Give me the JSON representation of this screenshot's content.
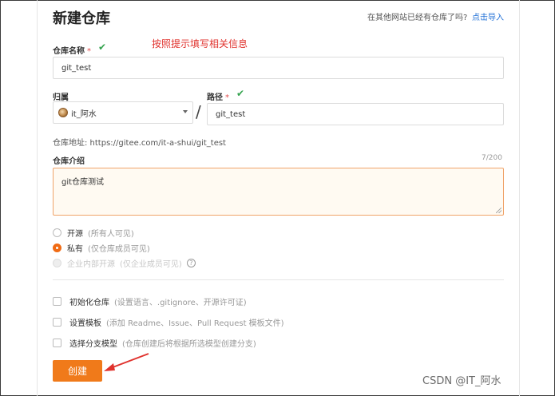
{
  "page": {
    "title": "新建仓库",
    "import_text": "在其他网站已经有仓库了吗?",
    "import_link": "点击导入"
  },
  "annotation": "按照提示填写相关信息",
  "repo_name": {
    "label": "仓库名称",
    "required_mark": "*",
    "value": "git_test"
  },
  "owner": {
    "label": "归属",
    "value": "it_阿水"
  },
  "separator": "/",
  "path": {
    "label": "路径",
    "required_mark": "*",
    "value": "git_test"
  },
  "repo_address": "仓库地址: https://gitee.com/it-a-shui/git_test",
  "description": {
    "label": "仓库介绍",
    "counter": "7/200",
    "value": "git仓库测试"
  },
  "visibility": [
    {
      "label": "开源",
      "note": "(所有人可见)",
      "selected": false,
      "disabled": false
    },
    {
      "label": "私有",
      "note": "(仅仓库成员可见)",
      "selected": true,
      "disabled": false
    },
    {
      "label": "企业内部开源",
      "note": "(仅企业成员可见)",
      "selected": false,
      "disabled": true
    }
  ],
  "help_icon": "?",
  "options": [
    {
      "label": "初始化仓库",
      "note": "(设置语言、.gitignore、开源许可证)"
    },
    {
      "label": "设置模板",
      "note": "(添加 Readme、Issue、Pull Request 模板文件)"
    },
    {
      "label": "选择分支模型",
      "note": "(仓库创建后将根据所选模型创建分支)"
    }
  ],
  "create_button": "创建",
  "watermark": "CSDN @IT_阿水",
  "colors": {
    "accent": "#f07a1a",
    "link": "#1f6fd6",
    "annotation": "#e0322d",
    "valid_check": "#34a34e"
  },
  "icons": {
    "valid": "check-icon",
    "help": "question-circle-icon",
    "dropdown": "chevron-down-icon",
    "pointer": "red-arrow-icon"
  }
}
